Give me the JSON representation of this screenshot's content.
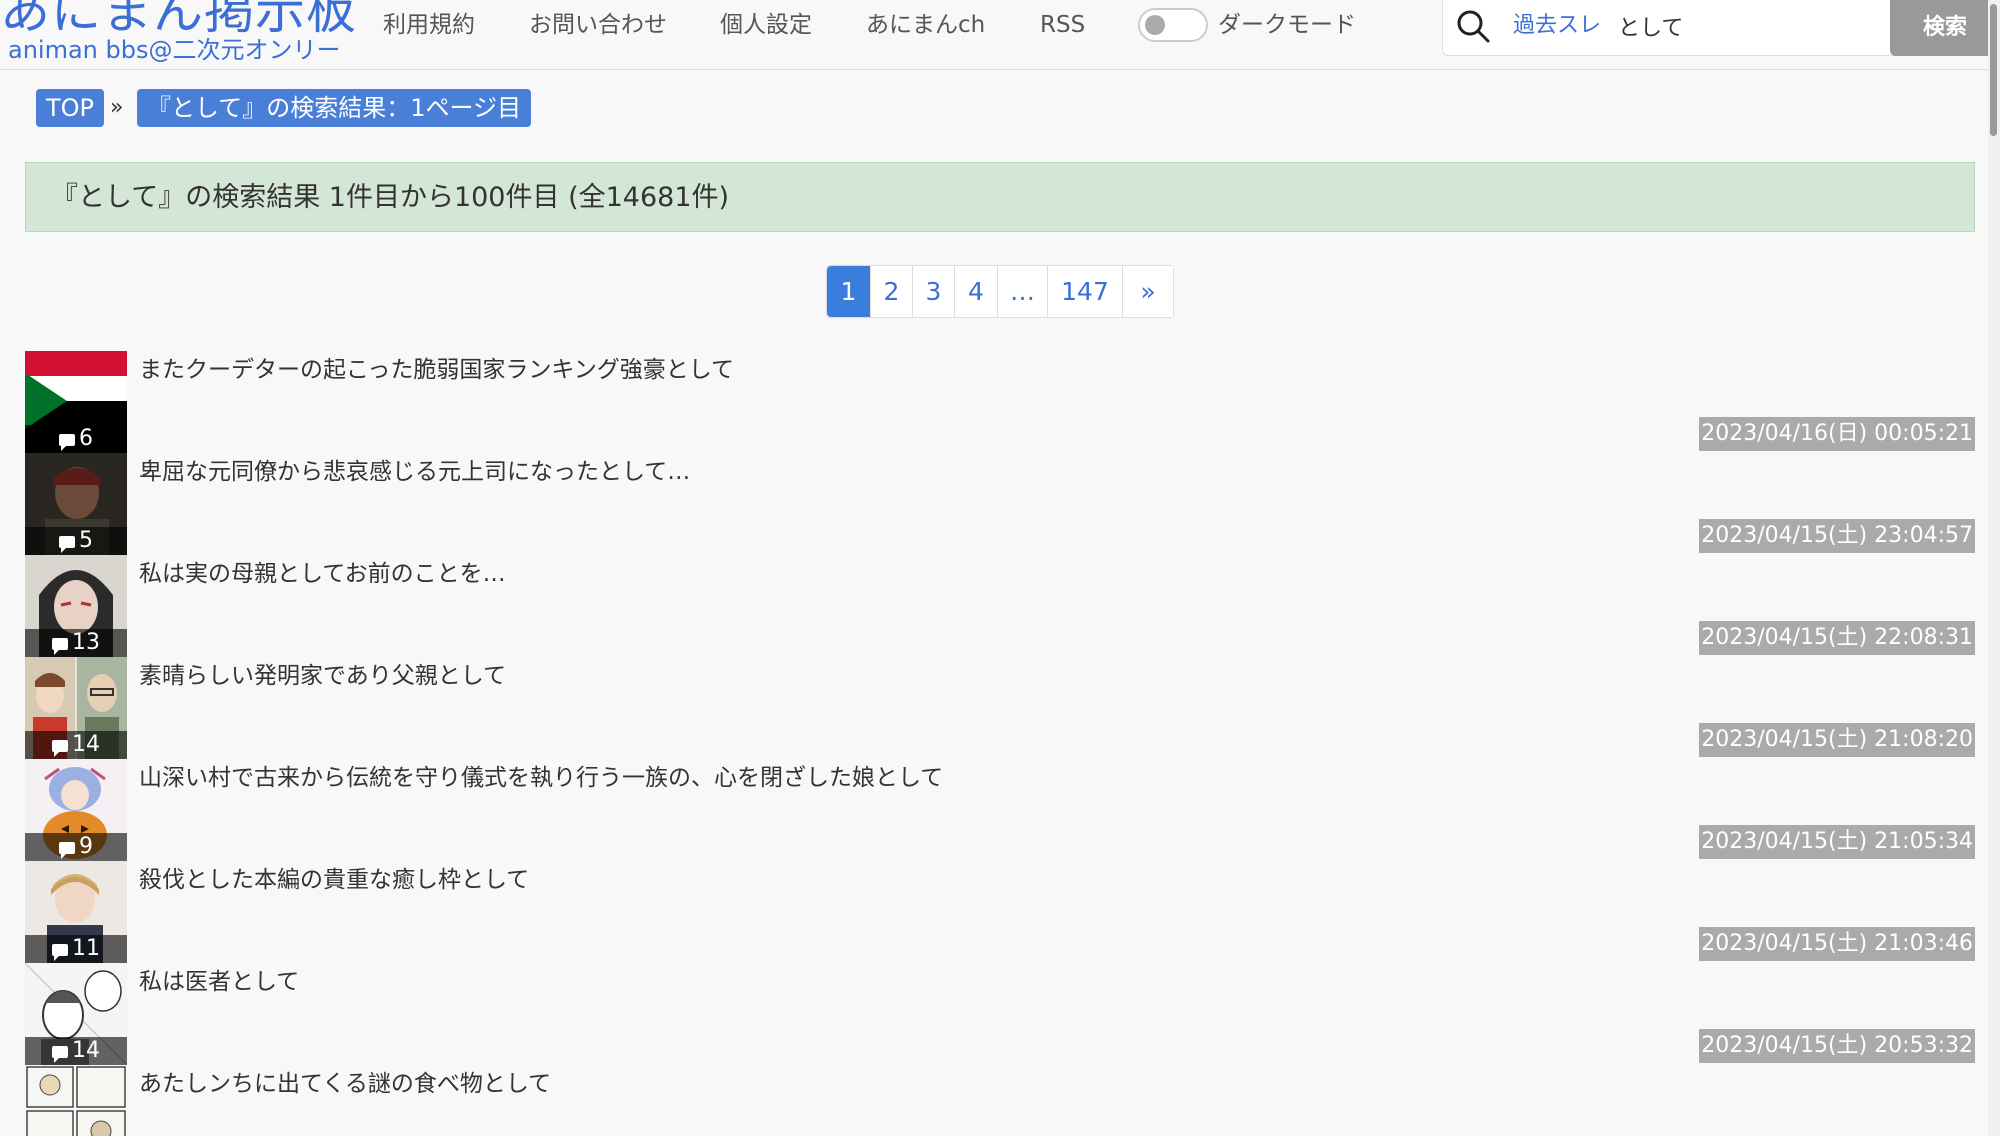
{
  "header": {
    "logo_title": "あにまん掲示板",
    "logo_subtitle": "animan bbs@二次元オンリー",
    "nav": [
      "利用規約",
      "お問い合わせ",
      "個人設定",
      "あにまんch",
      "RSS"
    ],
    "dark_mode_label": "ダークモード",
    "search": {
      "past_threads_link": "過去スレ",
      "query": "として",
      "button_label": "検索"
    }
  },
  "breadcrumb": {
    "top": "TOP",
    "separator": "»",
    "current": "『として』の検索結果：1ページ目"
  },
  "result_summary": "『として』の検索結果 1件目から100件目 (全14681件)",
  "pagination": {
    "pages": [
      "1",
      "2",
      "3",
      "4",
      "…",
      "147",
      "»"
    ],
    "current": "1"
  },
  "threads": [
    {
      "title": "またクーデターの起こった脆弱国家ランキング強豪として",
      "count": "6",
      "date": "2023/04/16(日) 00:05:21",
      "thumb": "sudan-flag"
    },
    {
      "title": "卑屈な元同僚から悲哀感じる元上司になったとして…",
      "count": "5",
      "date": "2023/04/15(土) 23:04:57",
      "thumb": "soldier-dark"
    },
    {
      "title": "私は実の母親としてお前のことを…",
      "count": "13",
      "date": "2023/04/15(土) 22:08:31",
      "thumb": "hooded-woman"
    },
    {
      "title": "素晴らしい発明家であり父親として",
      "count": "14",
      "date": "2023/04/15(土) 21:08:20",
      "thumb": "two-characters"
    },
    {
      "title": "山深い村で古来から伝統を守り儀式を執り行う一族の、心を閉ざした娘として",
      "count": "9",
      "date": "2023/04/15(土) 21:05:34",
      "thumb": "pumpkin-girl"
    },
    {
      "title": "殺伐とした本編の貴重な癒し枠として",
      "count": "11",
      "date": "2023/04/15(土) 21:03:46",
      "thumb": "blond-boy"
    },
    {
      "title": "私は医者として",
      "count": "14",
      "date": "2023/04/15(土) 20:53:32",
      "thumb": "manga-doctor"
    },
    {
      "title": "あたしンちに出てくる謎の食べ物として",
      "count": "",
      "date": "",
      "thumb": "manga-panels"
    }
  ],
  "colors": {
    "accent": "#3b6fd6",
    "breadcrumb_bg": "#4a7fd8",
    "banner_bg": "#d4e7d6",
    "date_bg": "#aaaaaa",
    "active_page": "#3b7ddd"
  }
}
